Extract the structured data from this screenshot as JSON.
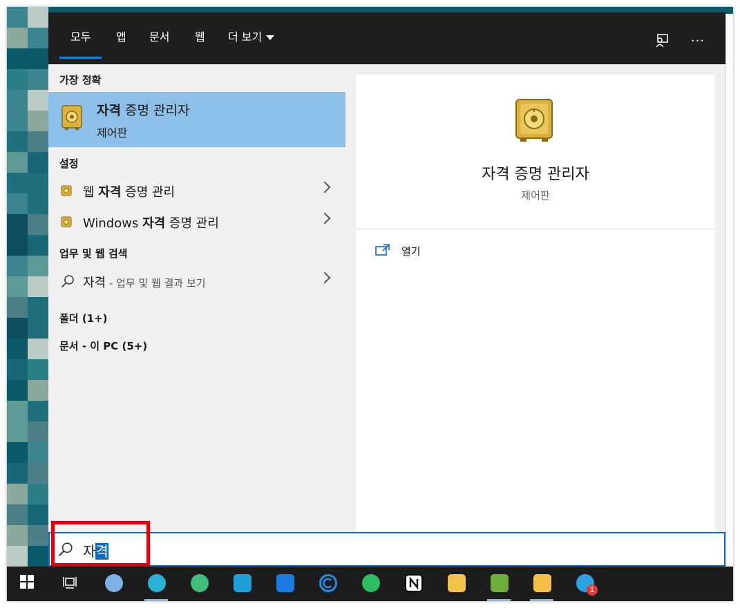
{
  "tabs": [
    {
      "label": "모두",
      "active": true
    },
    {
      "label": "앱",
      "active": false
    },
    {
      "label": "문서",
      "active": false
    },
    {
      "label": "웹",
      "active": false
    },
    {
      "label": "더 보기",
      "active": false
    }
  ],
  "top_icons": [
    "feedback-icon",
    "more-options-icon"
  ],
  "more_glyph": "···",
  "best_match": {
    "header": "가장 정확",
    "title_bold": "자격",
    "title_rest": " 증명 관리자",
    "subtitle": "제어판"
  },
  "settings": {
    "header": "설정",
    "items": [
      {
        "pre": "웹 ",
        "bold": "자격",
        "post": " 증명 관리"
      },
      {
        "pre": "Windows ",
        "bold": "자격",
        "post": " 증명 관리"
      }
    ]
  },
  "web_search": {
    "header": "업무 및 웹 검색",
    "query": "자격",
    "suffix": " - 업무 및 웹 결과 보기"
  },
  "folders_header": "폴더 (1+)",
  "documents_header": "문서 - 이 PC (5+)",
  "preview": {
    "title": "자격 증명 관리자",
    "subtitle": "제어판",
    "actions": [
      {
        "label": "열기",
        "icon": "open-icon"
      }
    ]
  },
  "search_box": {
    "text_plain": "자",
    "text_selected": "격"
  },
  "taskbar": {
    "apps": [
      {
        "name": "start-icon",
        "color": "#ffffff",
        "running": false
      },
      {
        "name": "task-view-icon",
        "color": "#ffffff",
        "running": false
      },
      {
        "name": "mail-icon",
        "color": "#7fb0e8",
        "running": false
      },
      {
        "name": "bird-app-icon",
        "color": "#2ab3d6",
        "running": true
      },
      {
        "name": "edge-icon",
        "color": "#3fbf7a",
        "running": false
      },
      {
        "name": "package-app-icon",
        "color": "#1e9fd8",
        "running": false
      },
      {
        "name": "calendar-icon",
        "color": "#1b7be0",
        "running": false
      },
      {
        "name": "c-app-icon",
        "color": "#1f8fe8",
        "running": false
      },
      {
        "name": "evernote-icon",
        "color": "#2dbe60",
        "running": false
      },
      {
        "name": "notion-icon",
        "color": "#ffffff",
        "running": false
      },
      {
        "name": "onedrive-folder-icon",
        "color": "#f3c24b",
        "running": false
      },
      {
        "name": "image-editor-icon",
        "color": "#6fae3c",
        "running": true
      },
      {
        "name": "file-explorer-icon",
        "color": "#f4c04a",
        "running": true
      },
      {
        "name": "telegram-icon",
        "color": "#2aa3e0",
        "running": false,
        "badge": "1"
      }
    ]
  }
}
